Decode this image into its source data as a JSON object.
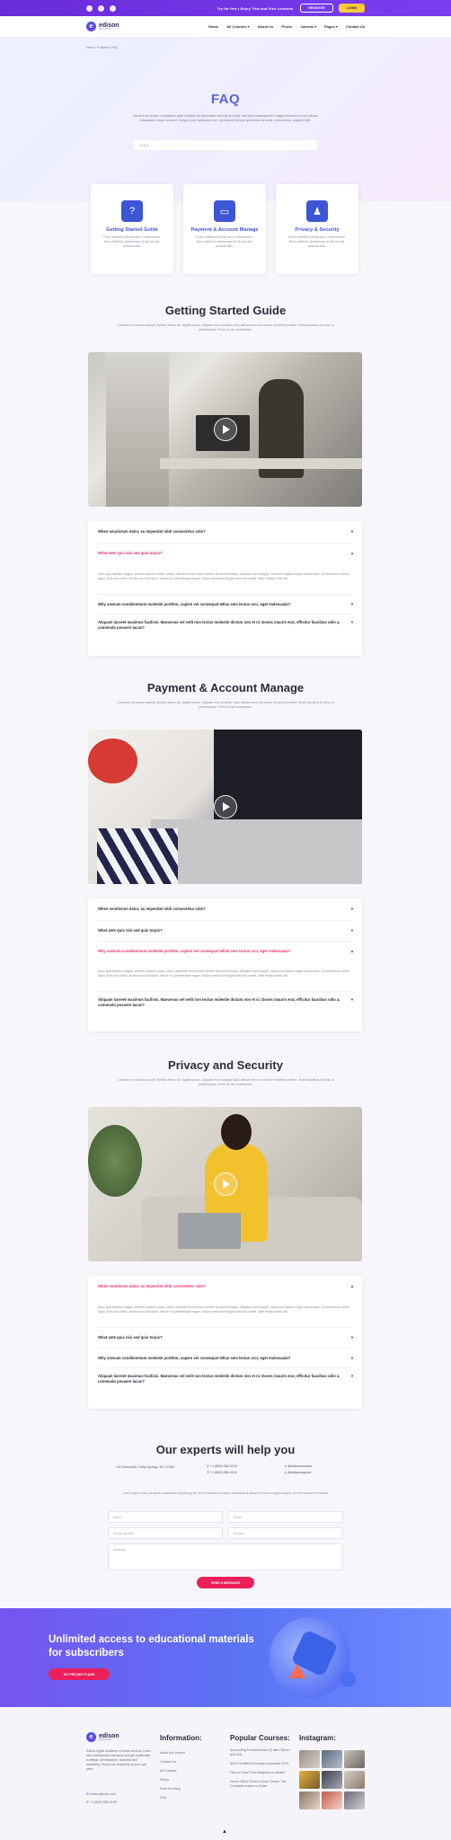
{
  "topbar": {
    "promo": "Try for free | Enjoy Trial and Free Lectures",
    "register": "REGISTER",
    "login": "LOGIN"
  },
  "nav": {
    "logo_name": "edison",
    "logo_sub": "EDUCATION",
    "items": [
      "Home",
      "All Courses",
      "About Us",
      "Prices",
      "Journal",
      "Pages",
      "Contact Us"
    ]
  },
  "hero": {
    "breadcrumb": "Home / Features / FAQ",
    "title": "FAQ",
    "text": "Nemo enim ipsam voluptatem quia voluptas sit aspernatur aut odit aut fugit, sed quia consequuntur magni dolores eos qui ratione voluptatem sequi nesciunt. Neque porro quisquam est, qui dolorem ipsum quia dolor sit amet, consectetur, adipisci velit.",
    "search_placeholder": "Search"
  },
  "cards": [
    {
      "title": "Getting Started Guide",
      "text": "Proin molestie pulvinar arcu in fermentum. Nunc eleifend, ullamcorper at vel nec dui, pulvinar felis."
    },
    {
      "title": "Payment & Account Manage",
      "text": "Proin molestie pulvinar arcu in fermentum. Nunc eleifend, ullamcorper at vel nec dui, pulvinar felis."
    },
    {
      "title": "Privacy & Security",
      "text": "Proin molestie pulvinar arcu in fermentum. Nunc eleifend, ullamcorper at vel nec dui, pulvinar felis."
    }
  ],
  "sections": [
    {
      "title": "Getting Started Guide",
      "subtitle": "Curabitur et massa suscipit, facilisis lectus sit, sagittis purus. Aliquam erat volutpat. Nam ultrices sem non lorem hendrerit porttitor. Morbi faucibus et dolor ut pellentesque. Proin id nisl consectetur.",
      "questions": [
        {
          "q": "When neudictum dolor, eu imperdiet nibh consectetur odio?",
          "open": false
        },
        {
          "q": "What ante quis nisi sed quis turpis?",
          "open": true,
          "a": "Nunc quis facilisis magna, sit amet posuere nulla. Donec imperdiet tortor lorem ultrices tincidunt tristique. Aliquam erat volutpat. Vivamus fringilla congue ullamcorper. Ut tincidunt et varius ligula. Duis sem tellus, lacinia non pulvinar in, dictum in, pellentesque augue. Etiam commodo feugiat nulla sed mattis. Nam tristique felis nisl."
        },
        {
          "q": "Why ssesum condimentum molestie porttitor, sapien vel consequat tellus sem lectus orci, eget malesuada?",
          "open": false
        },
        {
          "q": "Aliquam laoreet maximus facilisis. Maecenas vel velit non lectus molestie dictum non et ni. Donec mauris erat, efficitur faucibus odio a, commodo posuere lacus?",
          "open": false
        }
      ]
    },
    {
      "title": "Payment & Account Manage",
      "subtitle": "Curabitur et massa suscipit, facilisis lectus sit, sagittis purus. Aliquam erat volutpat. Nam ultrices sem non lorem hendrerit porttitor. Morbi faucibus et dolor ut pellentesque. Proin id nisl consectetur.",
      "questions": [
        {
          "q": "When neudictum dolor, eu imperdiet nibh consectetur odio?",
          "open": false
        },
        {
          "q": "What ante quis nisi sed quis turpis?",
          "open": false
        },
        {
          "q": "Why ssesum condimentum molestie porttitor, sapien vel consequat tellus sem lectus orci, eget malesuada?",
          "open": true,
          "a": "Nunc quis facilisis magna, sit amet posuere nulla. Donec imperdiet tortor lorem ultrices tincidunt tristique. Aliquam erat volutpat. Vivamus fringilla congue ullamcorper. Ut tincidunt et varius ligula. Duis sem tellus, lacinia non pulvinar in, dictum in, pellentesque augue. Etiam commodo feugiat nulla sed mattis. Nam tristique felis nisl."
        },
        {
          "q": "Aliquam laoreet maximus facilisis. Maecenas vel velit non lectus molestie dictum non et ni. Donec mauris erat, efficitur faucibus odio a, commodo posuere lacus?",
          "open": false
        }
      ]
    },
    {
      "title": "Privacy and Security",
      "subtitle": "Curabitur et massa suscipit, facilisis lectus sit, sagittis purus. Aliquam erat volutpat. Nam ultrices sem non lorem hendrerit porttitor. Morbi faucibus et dolor ut pellentesque. Proin id nisl consectetur.",
      "questions": [
        {
          "q": "When neudictum dolor, eu imperdiet nibh consectetur odio?",
          "open": true,
          "a": "Nunc quis facilisis magna, sit amet posuere nulla. Donec imperdiet tortor lorem ultrices tincidunt tristique. Aliquam erat volutpat. Vivamus fringilla congue ullamcorper. Ut tincidunt et varius ligula. Duis sem tellus, lacinia non pulvinar in, dictum in, pellentesque augue. Etiam commodo feugiat nulla sed mattis. Nam tristique felis nisl."
        },
        {
          "q": "What ante quis nisi sed quis turpis?",
          "open": false
        },
        {
          "q": "Why ssesum condimentum molestie porttitor, sapien vel consequat tellus sem lectus orci, eget malesuada?",
          "open": false
        },
        {
          "q": "Aliquam laoreet maximus facilisis. Maecenas vel velit non lectus molestie dictum non et ni. Donec mauris erat, efficitur faucibus odio a, commodo posuere lacus?",
          "open": false
        }
      ]
    }
  ],
  "experts": {
    "title": "Our experts will help you",
    "address": "62 Wood Ave, Holly Springs, NC 27540",
    "phone1": "+1 (800) 555-0100",
    "phone2": "+1 (800) 555-0101",
    "social1": "@edisoncourses",
    "social2": "@edisonsupport",
    "note": "Lorem ipsum dolor sit amet consectetur adipiscing elit sed do eiusmod tempor incididunt ut labore et dolore magna aliqua. Ut enim ad minim veniam.",
    "name_ph": "Name",
    "email_ph": "Email",
    "phone_ph": "Phone Number",
    "subject_ph": "Subject",
    "message_ph": "Message",
    "send": "SEND A MESSAGE"
  },
  "banner": {
    "title": "Unlimited access to educational materials for subscribers",
    "button": "GO PRICING PLANS"
  },
  "footer": {
    "about": "Edison digital academy of online courses. Learn with professional instructors and get certificates in design, development, business and marketing. Study from anywhere at your own pace.",
    "email": "edison@mail.com",
    "phone": "+1 (800) 555-0199",
    "info_title": "Information:",
    "info_links": [
      "About this project",
      "Contact Us",
      "All Courses",
      "Prices",
      "From the Blog",
      "FAQ"
    ],
    "courses_title": "Popular Courses:",
    "courses": [
      "Accounting Fundamentals (2) with Python and SQL",
      "AWS Certified Developer Associate 2023",
      "How to Draw From Beginner to Master",
      "Invest: Micro Series Shows Series: The Complete Advisor's Guide"
    ],
    "instagram_title": "Instagram:"
  },
  "colors": {
    "primary": "#3d56d6",
    "accent": "#e8306b",
    "topbar": "#6a2bd9",
    "banner": "#5a74f5"
  }
}
